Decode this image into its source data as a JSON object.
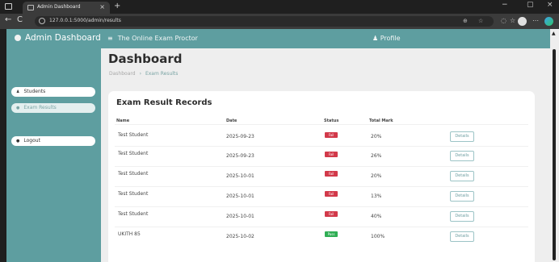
{
  "browser": {
    "tab_title": "Admin Dashboard",
    "tab_close": "×",
    "new_tab": "+",
    "url": "127.0.0.1:5000/admin/results",
    "back": "←",
    "reload": "C",
    "win_min": "−",
    "win_max": "▢",
    "win_close": "×"
  },
  "topnav": {
    "brand": "Admin Dashboard",
    "menu_icon": "≡",
    "title": "The Online Exam Proctor",
    "profile": "Profile",
    "profile_icon": "person-icon"
  },
  "sidebar": {
    "items": [
      {
        "label": "Students",
        "icon": "user-icon"
      },
      {
        "label": "Exam Results",
        "icon": "chart-icon"
      },
      {
        "label": "Logout",
        "icon": "logout-icon"
      }
    ]
  },
  "main": {
    "title": "Dashboard",
    "breadcrumb": {
      "home": "Dashboard",
      "separator": "›",
      "current": "Exam Results"
    }
  },
  "card": {
    "title": "Exam Result Records",
    "columns": [
      "Name",
      "Date",
      "Status",
      "Total Mark"
    ],
    "rows": [
      {
        "name": "Test Student",
        "date": "2025-09-23",
        "status": "Fail",
        "mark": "20%",
        "action": "Details"
      },
      {
        "name": "Test Student",
        "date": "2025-09-23",
        "status": "Fail",
        "mark": "26%",
        "action": "Details"
      },
      {
        "name": "Test Student",
        "date": "2025-10-01",
        "status": "Fail",
        "mark": "20%",
        "action": "Details"
      },
      {
        "name": "Test Student",
        "date": "2025-10-01",
        "status": "Fail",
        "mark": "13%",
        "action": "Details"
      },
      {
        "name": "Test Student",
        "date": "2025-10-01",
        "status": "Fail",
        "mark": "40%",
        "action": "Details"
      },
      {
        "name": "UKITH 85",
        "date": "2025-10-02",
        "status": "Pass",
        "mark": "100%",
        "action": "Details"
      }
    ]
  },
  "colors": {
    "teal": "#5e9ea0",
    "fail": "#d2394a",
    "pass": "#2fae54"
  }
}
